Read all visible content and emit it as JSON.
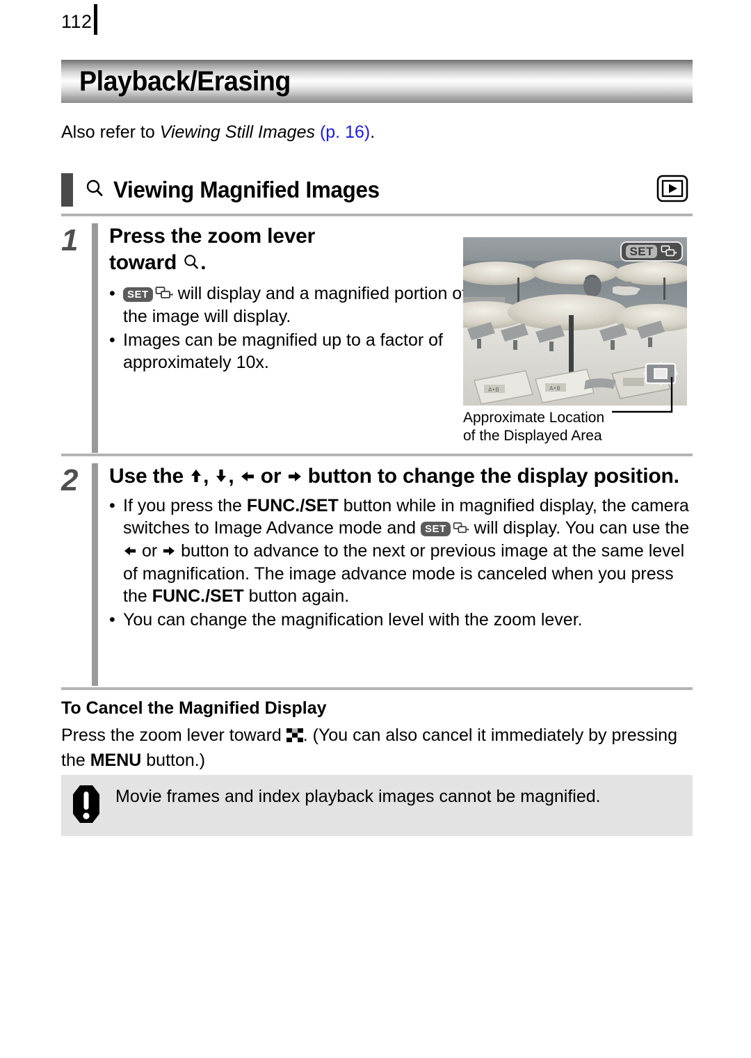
{
  "page": {
    "number": "112",
    "chapter_title": "Playback/Erasing"
  },
  "refer": {
    "prefix": "Also refer to ",
    "italic_title": "Viewing Still Images",
    "page_link": " (p. 16)",
    "suffix": "."
  },
  "section": {
    "title": "Viewing Magnified Images",
    "left_icon": "magnifier-icon",
    "right_icon": "playback-mode-icon"
  },
  "steps": [
    {
      "number": "1",
      "title_line1": "Press the zoom lever",
      "title_line2_prefix": "toward ",
      "title_line2_suffix": ".",
      "bullets": [
        {
          "before": "",
          "has_set_icon": true,
          "after": " will display and a magnified portion of the image will display."
        },
        {
          "text": "Images can be magnified up to a factor of approximately 10x."
        }
      ]
    },
    {
      "number": "2",
      "title_prefix": "Use the ",
      "title_mid": ", ",
      "title_or": " or ",
      "title_suffix": " button to change the display position.",
      "bullets": [
        {
          "p1": "If you press the ",
          "b1": "FUNC./SET",
          "p2": " button while in magnified display, the camera switches to Image Advance mode and ",
          "p3": " will display. You can use the ",
          "p4": " or ",
          "p5": " button to advance to the next or previous image at the same level of magnification. The image advance mode is canceled when you press the ",
          "b2": "FUNC./SET",
          "p6": " button again."
        },
        {
          "text": "You can change the magnification level with the zoom lever."
        }
      ]
    }
  ],
  "figure": {
    "badge_set_label": "SET",
    "badge_icon": "image-advance-icon",
    "caption_line1": "Approximate Location",
    "caption_line2": "of the Displayed Area",
    "location_indicator": "displayed-area-indicator"
  },
  "cancel_section": {
    "heading": "To Cancel the Magnified Display",
    "text_before": "Press the zoom lever toward ",
    "text_after_icon": ". (You can also cancel it immediately by pressing the ",
    "menu_label": "MENU",
    "text_end": " button.)"
  },
  "note": {
    "icon": "caution-exclamation-icon",
    "text": "Movie frames and index playback images cannot be magnified."
  },
  "colors": {
    "link": "#1a1aee",
    "banner_dark": "#6f6f6f",
    "section_bar": "#4a4a4a",
    "step_divider": "#9a9a9a",
    "note_bg": "#e3e3e3"
  }
}
